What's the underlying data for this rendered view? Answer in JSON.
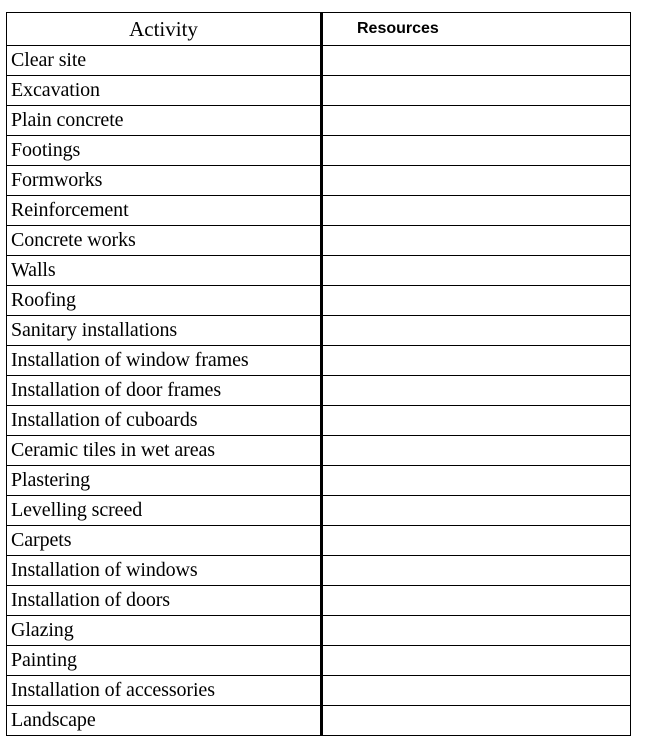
{
  "table": {
    "columns": [
      {
        "key": "activity",
        "label": "Activity",
        "align": "center"
      },
      {
        "key": "resources",
        "label": "Resources",
        "align": "left"
      }
    ],
    "header": {
      "activity": "Activity",
      "resources": "Resources"
    },
    "rows": [
      {
        "activity": "Clear site",
        "resources": ""
      },
      {
        "activity": "Excavation",
        "resources": ""
      },
      {
        "activity": "Plain concrete",
        "resources": ""
      },
      {
        "activity": "Footings",
        "resources": ""
      },
      {
        "activity": "Formworks",
        "resources": ""
      },
      {
        "activity": "Reinforcement",
        "resources": ""
      },
      {
        "activity": "Concrete works",
        "resources": ""
      },
      {
        "activity": "Walls",
        "resources": ""
      },
      {
        "activity": "Roofing",
        "resources": ""
      },
      {
        "activity": "Sanitary installations",
        "resources": ""
      },
      {
        "activity": "Installation of window frames",
        "resources": ""
      },
      {
        "activity": "Installation of door frames",
        "resources": ""
      },
      {
        "activity": "Installation of cuboards",
        "resources": ""
      },
      {
        "activity": "Ceramic tiles in wet areas",
        "resources": ""
      },
      {
        "activity": "Plastering",
        "resources": ""
      },
      {
        "activity": "Levelling screed",
        "resources": ""
      },
      {
        "activity": "Carpets",
        "resources": ""
      },
      {
        "activity": "Installation of windows",
        "resources": ""
      },
      {
        "activity": "Installation of doors",
        "resources": ""
      },
      {
        "activity": "Glazing",
        "resources": ""
      },
      {
        "activity": "Painting",
        "resources": ""
      },
      {
        "activity": "Installation of accessories",
        "resources": ""
      },
      {
        "activity": "Landscape",
        "resources": ""
      }
    ]
  },
  "style": {
    "page_background": "#ffffff",
    "text_color": "#000000",
    "border_color": "#000000"
  }
}
